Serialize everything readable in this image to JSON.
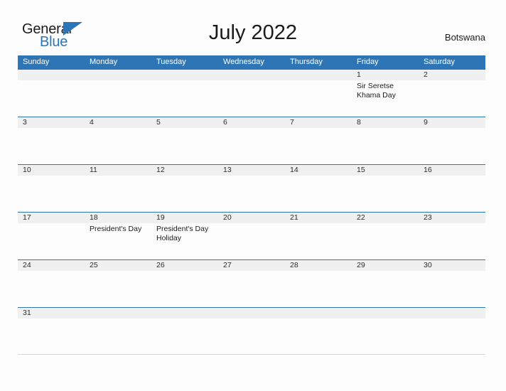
{
  "brand": {
    "word_one": "General",
    "word_two": "Blue",
    "triangle_icon": "triangle-right-icon",
    "accent_color": "#2b74b8"
  },
  "header": {
    "title": "July 2022",
    "country": "Botswana"
  },
  "theme": {
    "header_blue": "#2e75b6",
    "date_strip_gray": "#f0f0f0",
    "row_rule": "#2e75b6"
  },
  "calendar": {
    "weekdays": [
      "Sunday",
      "Monday",
      "Tuesday",
      "Wednesday",
      "Thursday",
      "Friday",
      "Saturday"
    ],
    "weeks": [
      {
        "days": [
          {
            "date": "",
            "event": ""
          },
          {
            "date": "",
            "event": ""
          },
          {
            "date": "",
            "event": ""
          },
          {
            "date": "",
            "event": ""
          },
          {
            "date": "",
            "event": ""
          },
          {
            "date": "1",
            "event": "Sir Seretse Khama Day"
          },
          {
            "date": "2",
            "event": ""
          }
        ]
      },
      {
        "days": [
          {
            "date": "3",
            "event": ""
          },
          {
            "date": "4",
            "event": ""
          },
          {
            "date": "5",
            "event": ""
          },
          {
            "date": "6",
            "event": ""
          },
          {
            "date": "7",
            "event": ""
          },
          {
            "date": "8",
            "event": ""
          },
          {
            "date": "9",
            "event": ""
          }
        ]
      },
      {
        "days": [
          {
            "date": "10",
            "event": ""
          },
          {
            "date": "11",
            "event": ""
          },
          {
            "date": "12",
            "event": ""
          },
          {
            "date": "13",
            "event": ""
          },
          {
            "date": "14",
            "event": ""
          },
          {
            "date": "15",
            "event": ""
          },
          {
            "date": "16",
            "event": ""
          }
        ]
      },
      {
        "days": [
          {
            "date": "17",
            "event": ""
          },
          {
            "date": "18",
            "event": "President's Day"
          },
          {
            "date": "19",
            "event": "President's Day Holiday"
          },
          {
            "date": "20",
            "event": ""
          },
          {
            "date": "21",
            "event": ""
          },
          {
            "date": "22",
            "event": ""
          },
          {
            "date": "23",
            "event": ""
          }
        ]
      },
      {
        "days": [
          {
            "date": "24",
            "event": ""
          },
          {
            "date": "25",
            "event": ""
          },
          {
            "date": "26",
            "event": ""
          },
          {
            "date": "27",
            "event": ""
          },
          {
            "date": "28",
            "event": ""
          },
          {
            "date": "29",
            "event": ""
          },
          {
            "date": "30",
            "event": ""
          }
        ]
      },
      {
        "days": [
          {
            "date": "31",
            "event": ""
          },
          {
            "date": "",
            "event": ""
          },
          {
            "date": "",
            "event": ""
          },
          {
            "date": "",
            "event": ""
          },
          {
            "date": "",
            "event": ""
          },
          {
            "date": "",
            "event": ""
          },
          {
            "date": "",
            "event": ""
          }
        ]
      }
    ]
  }
}
